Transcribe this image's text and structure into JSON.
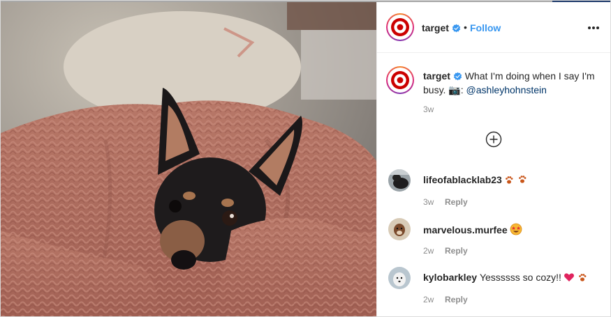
{
  "post": {
    "author": "target",
    "follow_label": "Follow",
    "separator": "•",
    "caption": {
      "author": "target",
      "text": "What I'm doing when I say I'm busy. 📷: ",
      "mention": "@ashleyhohnstein",
      "time": "3w"
    }
  },
  "comments": [
    {
      "username": "lifeofablacklab23",
      "text": "",
      "time": "3w",
      "reply_label": "Reply"
    },
    {
      "username": "marvelous.murfee",
      "text": "",
      "time": "2w",
      "reply_label": "Reply"
    },
    {
      "username": "kylobarkley",
      "text": "Yessssss so cozy!!",
      "time": "2w",
      "reply_label": "Reply"
    }
  ],
  "icons": {
    "verified": "verified-badge-icon",
    "more": "more-options-icon",
    "load_more": "plus-circle-icon",
    "paws": "paw-prints-icon",
    "star_eyes": "star-struck-emoji-icon",
    "heart": "red-heart-icon"
  },
  "colors": {
    "follow": "#3897f0",
    "verified": "#3897f0",
    "mention": "#003569",
    "timestamp": "#8e8e8e",
    "brand_red": "#cc0000"
  }
}
